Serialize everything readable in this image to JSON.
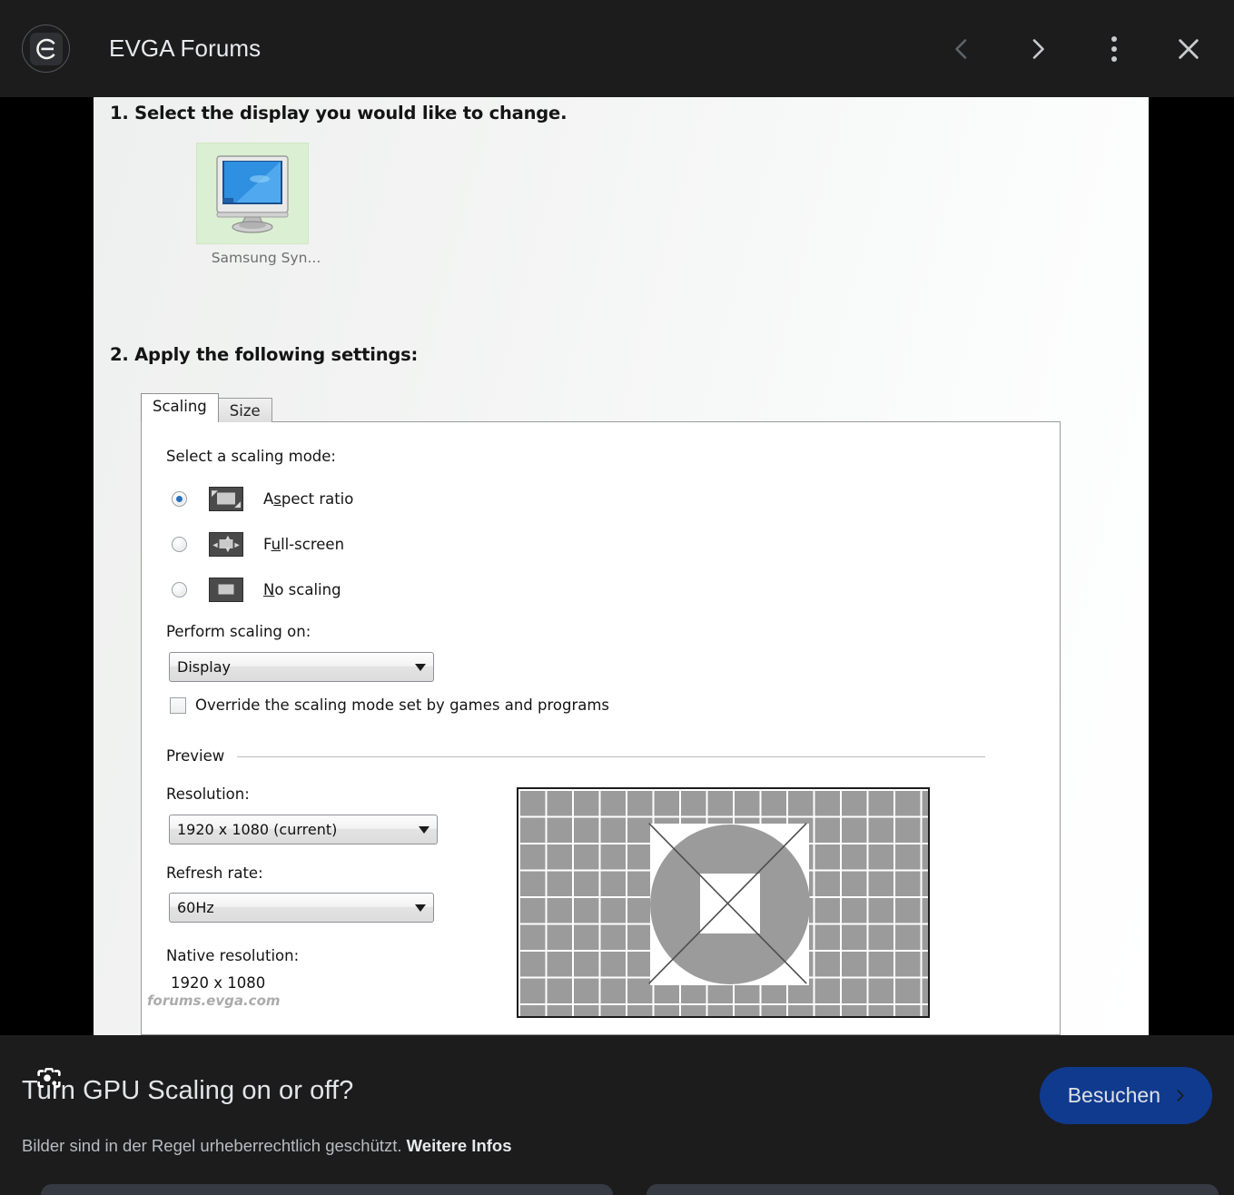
{
  "appbar": {
    "title": "EVGA Forums",
    "logo_alt": "evga-logo",
    "prev_label": "Vorherige",
    "next_label": "Nächste",
    "menu_label": "Mehr",
    "close_label": "Schließen"
  },
  "stage": {
    "lens_label": "Google Lens"
  },
  "screenshot": {
    "step1_heading": "1. Select the display you would like to change.",
    "display_tile_label": "Samsung Syn...",
    "step2_heading": "2. Apply the following settings:",
    "tabs": [
      {
        "label": "Scaling",
        "active": true
      },
      {
        "label": "Size",
        "active": false
      }
    ],
    "scaling_mode_label": "Select a scaling mode:",
    "modes": [
      {
        "label": "Aspect ratio",
        "accesskey": "s",
        "selected": true,
        "icon": "aspect-ratio-icon"
      },
      {
        "label": "Full-screen",
        "accesskey": "u",
        "selected": false,
        "icon": "full-screen-icon"
      },
      {
        "label": "No scaling",
        "accesskey": "N",
        "selected": false,
        "icon": "no-scaling-icon"
      }
    ],
    "perform_scaling_label": "Perform scaling on:",
    "perform_scaling_value": "Display",
    "override_checkbox_label": "Override the scaling mode set by games and programs",
    "override_checked": false,
    "preview_group_label": "Preview",
    "resolution_label": "Resolution:",
    "resolution_value": "1920 x 1080 (current)",
    "refresh_label": "Refresh rate:",
    "refresh_value": "60Hz",
    "native_label": "Native resolution:",
    "native_value": "1920 x 1080",
    "watermark": "forums.evga.com"
  },
  "infobar": {
    "title": "Turn GPU Scaling on or off?",
    "copyright_text": "Bilder sind in der Regel urheberrechtlich geschützt.",
    "more_info": "Weitere Infos",
    "visit_label": "Besuchen"
  },
  "colors": {
    "chrome_bg": "#1c1c1d",
    "stage_bg": "#000000",
    "visit_button": "#103a8e",
    "accent_radio": "#2a6fbe",
    "tile_selection": "#dbf0d2"
  }
}
